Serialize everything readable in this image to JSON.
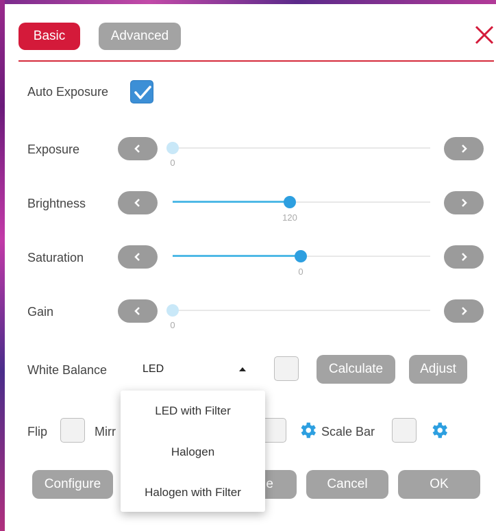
{
  "tabs": {
    "basic": "Basic",
    "advanced": "Advanced"
  },
  "auto_exposure": {
    "label": "Auto Exposure",
    "checked": true
  },
  "sliders": {
    "exposure": {
      "label": "Exposure",
      "value": "0"
    },
    "brightness": {
      "label": "Brightness",
      "value": "120"
    },
    "saturation": {
      "label": "Saturation",
      "value": "0"
    },
    "gain": {
      "label": "Gain",
      "value": "0"
    }
  },
  "white_balance": {
    "label": "White Balance",
    "selected": "LED",
    "calculate": "Calculate",
    "adjust": "Adjust",
    "options": [
      "LED with Filter",
      "Halogen",
      "Halogen with Filter"
    ]
  },
  "toggles": {
    "flip": "Flip",
    "mirror_partial": "Mirr",
    "scale_bar": "Scale Bar"
  },
  "footer": {
    "configure": "Configure",
    "hidden_partial": "e",
    "cancel": "Cancel",
    "ok": "OK"
  },
  "colors": {
    "accent": "#d41a3a",
    "button_gray": "#a3a3a3",
    "slider_blue": "#2d9fe0",
    "checkbox_blue": "#3c8fd6"
  }
}
